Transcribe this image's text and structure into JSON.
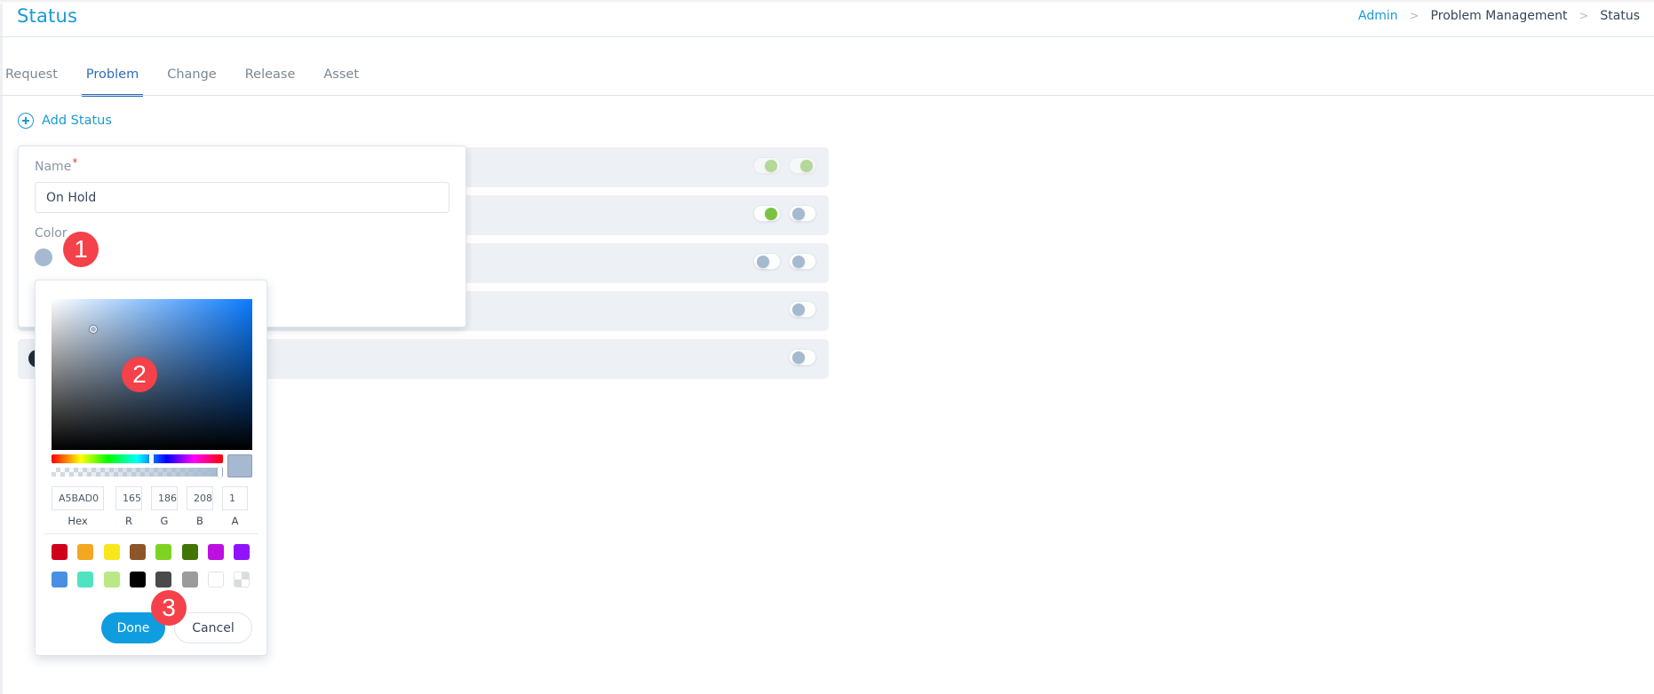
{
  "header": {
    "title": "Status",
    "breadcrumb": [
      "Admin",
      "Problem Management",
      "Status"
    ],
    "breadcrumb_separator": ">"
  },
  "tabs": [
    {
      "label": "Request",
      "active": false
    },
    {
      "label": "Problem",
      "active": true
    },
    {
      "label": "Change",
      "active": false
    },
    {
      "label": "Release",
      "active": false
    },
    {
      "label": "Asset",
      "active": false
    }
  ],
  "add_status": {
    "label": "Add Status",
    "icon": "plus-circle-icon"
  },
  "status_rows": [
    {
      "toggles": [
        "on-disabled",
        "on-disabled"
      ]
    },
    {
      "toggles": [
        "on",
        "off"
      ]
    },
    {
      "toggles": [
        "off",
        "off"
      ]
    },
    {
      "toggles": [
        "off"
      ]
    },
    {
      "toggles": [
        "off"
      ],
      "color_dot": "#1d2a38"
    }
  ],
  "form": {
    "name_label": "Name",
    "required_mark": "*",
    "name_value": "On Hold",
    "color_label": "Color",
    "color_value": "#a5bad0"
  },
  "color_picker": {
    "hex": "A5BAD0",
    "r": "165",
    "g": "186",
    "b": "208",
    "a": "1",
    "labels": {
      "hex": "Hex",
      "r": "R",
      "g": "G",
      "b": "B",
      "a": "A"
    },
    "hue_color": "#0a7bff",
    "presets": [
      "#d0021b",
      "#f5a623",
      "#f8e71c",
      "#8b572a",
      "#7ed321",
      "#417505",
      "#bd10e0",
      "#9013fe",
      "#4a90e2",
      "#50e3c2",
      "#b8e986",
      "#000000",
      "#4a4a4a",
      "#9b9b9b",
      "#ffffff",
      "transparent"
    ],
    "done_label": "Done",
    "cancel_label": "Cancel"
  },
  "annotations": [
    "1",
    "2",
    "3"
  ],
  "colors": {
    "accent": "#1a9ad6",
    "tab_active": "#2d6db5",
    "toggle_on": "#7cc242",
    "toggle_off": "#a5bad0",
    "badge": "#f4414a",
    "done_button": "#0f9ddf"
  }
}
